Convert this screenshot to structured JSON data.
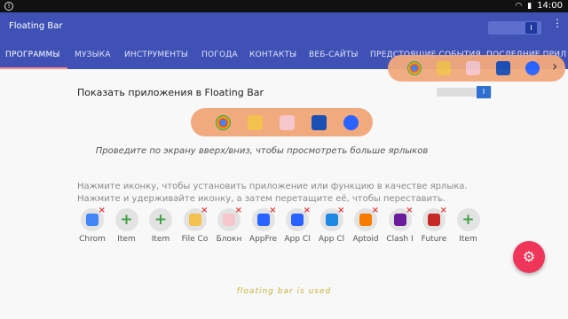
{
  "status_bar": {
    "time": "14:00"
  },
  "app": {
    "title": "Floating Bar",
    "toggle_label": "I",
    "menu_glyph": "⋮"
  },
  "tabs": [
    {
      "label": "ПРОГРАММЫ"
    },
    {
      "label": "МУЗЫКА"
    },
    {
      "label": "ИНСТРУМЕНТЫ"
    },
    {
      "label": "ПОГОДА"
    },
    {
      "label": "КОНТАКТЫ"
    },
    {
      "label": "ВЕБ-САЙТЫ"
    },
    {
      "label": "ПРЕДСТОЯЩИЕ СОБЫТИЯ"
    },
    {
      "label": "ПОСЛЕДНИЕ ПРИЛ"
    }
  ],
  "main": {
    "heading": "Показать приложения в Floating Bar",
    "switch_label": "I",
    "hint": "Проведите по экрану вверх/вниз, чтобы просмотреть больше ярлыков",
    "instructions": "Нажмите иконку, чтобы установить приложение или функцию в качестве ярлыка. Нажмите и удерживайте иконку, а затем перетащите её, чтобы переставить."
  },
  "shortcut_icons": [
    "chrome-icon",
    "file-commander-icon",
    "notepad-icon",
    "app-cloner-icon",
    "app-cloner-alt-icon"
  ],
  "apps": [
    {
      "label": "Chrom",
      "type": "app",
      "color": "#4285f4"
    },
    {
      "label": "Item",
      "type": "empty"
    },
    {
      "label": "Item",
      "type": "empty"
    },
    {
      "label": "File Co",
      "type": "app",
      "color": "#f2c14e"
    },
    {
      "label": "Блокн",
      "type": "app",
      "color": "#f5c6cb"
    },
    {
      "label": "AppFre",
      "type": "app",
      "color": "#2962ff"
    },
    {
      "label": "App Cl",
      "type": "app",
      "color": "#2962ff"
    },
    {
      "label": "App Cl",
      "type": "app",
      "color": "#1e88e5"
    },
    {
      "label": "Aptoid",
      "type": "app",
      "color": "#f57c00"
    },
    {
      "label": "Clash I",
      "type": "app",
      "color": "#6a1b9a"
    },
    {
      "label": "Future",
      "type": "app",
      "color": "#c62828"
    },
    {
      "label": "Item",
      "type": "empty"
    }
  ],
  "fab": {
    "glyph": "⚙"
  },
  "footer": "floating bar is used"
}
